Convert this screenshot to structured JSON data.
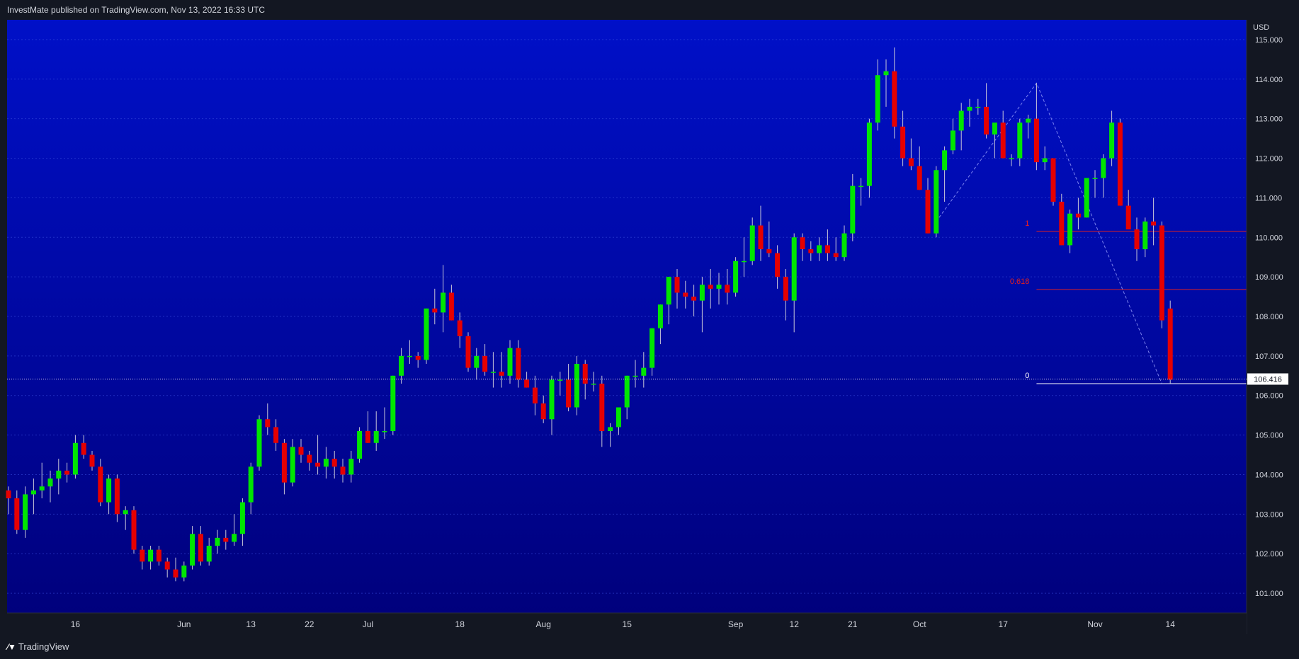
{
  "header": {
    "published": "InvestMate published on TradingView.com, Nov 13, 2022 16:33 UTC"
  },
  "footer": {
    "brand": "TradingView",
    "logo_icon": "tradingview-logo-icon"
  },
  "colors": {
    "bg_top": "#0010c8",
    "bg_bottom": "#00007a",
    "up": "#00e600",
    "down": "#e60000",
    "fib": "#e02020"
  },
  "chart_data": {
    "type": "candlestick",
    "currency": "USD",
    "ylim": [
      100.5,
      115.5
    ],
    "y_ticks": [
      "101.000",
      "102.000",
      "103.000",
      "104.000",
      "105.000",
      "106.000",
      "107.000",
      "108.000",
      "109.000",
      "110.000",
      "111.000",
      "112.000",
      "113.000",
      "114.000",
      "115.000"
    ],
    "x_ticks": [
      {
        "label": "16",
        "index": 8
      },
      {
        "label": "Jun",
        "index": 21
      },
      {
        "label": "13",
        "index": 29
      },
      {
        "label": "22",
        "index": 36
      },
      {
        "label": "Jul",
        "index": 43
      },
      {
        "label": "18",
        "index": 54
      },
      {
        "label": "Aug",
        "index": 64
      },
      {
        "label": "15",
        "index": 74
      },
      {
        "label": "Sep",
        "index": 87
      },
      {
        "label": "12",
        "index": 94
      },
      {
        "label": "21",
        "index": 101
      },
      {
        "label": "Oct",
        "index": 109
      },
      {
        "label": "17",
        "index": 119
      },
      {
        "label": "Nov",
        "index": 130
      },
      {
        "label": "14",
        "index": 139
      }
    ],
    "last_price": "106.416",
    "last_value": 106.416,
    "fib": [
      {
        "label": "1",
        "value": 110.15
      },
      {
        "label": "0.618",
        "value": 108.68
      },
      {
        "label": "0",
        "value": 106.3
      }
    ],
    "zigzag": [
      [
        111,
        110.4
      ],
      [
        123,
        113.9
      ],
      [
        138,
        106.3
      ]
    ],
    "candles": [
      [
        103.6,
        103.7,
        103.0,
        103.4
      ],
      [
        103.4,
        103.6,
        102.5,
        102.6
      ],
      [
        102.6,
        103.7,
        102.4,
        103.5
      ],
      [
        103.5,
        103.9,
        103.0,
        103.6
      ],
      [
        103.6,
        104.3,
        103.4,
        103.7
      ],
      [
        103.7,
        104.1,
        103.3,
        103.9
      ],
      [
        103.9,
        104.4,
        103.5,
        104.1
      ],
      [
        104.1,
        104.3,
        103.8,
        104.0
      ],
      [
        104.0,
        105.0,
        103.9,
        104.8
      ],
      [
        104.8,
        105.0,
        104.4,
        104.5
      ],
      [
        104.5,
        104.6,
        104.1,
        104.2
      ],
      [
        104.2,
        104.4,
        103.2,
        103.3
      ],
      [
        103.3,
        104.0,
        103.0,
        103.9
      ],
      [
        103.9,
        104.0,
        102.8,
        103.0
      ],
      [
        103.0,
        103.2,
        102.6,
        103.1
      ],
      [
        103.1,
        103.2,
        102.0,
        102.1
      ],
      [
        102.1,
        102.2,
        101.6,
        101.8
      ],
      [
        101.8,
        102.2,
        101.6,
        102.1
      ],
      [
        102.1,
        102.2,
        101.7,
        101.8
      ],
      [
        101.8,
        101.9,
        101.4,
        101.6
      ],
      [
        101.6,
        101.9,
        101.3,
        101.4
      ],
      [
        101.4,
        101.8,
        101.3,
        101.7
      ],
      [
        101.7,
        102.7,
        101.6,
        102.5
      ],
      [
        102.5,
        102.7,
        101.7,
        101.8
      ],
      [
        101.8,
        102.4,
        101.7,
        102.2
      ],
      [
        102.2,
        102.6,
        102.0,
        102.4
      ],
      [
        102.4,
        102.6,
        102.1,
        102.3
      ],
      [
        102.3,
        103.0,
        102.2,
        102.5
      ],
      [
        102.5,
        103.4,
        102.2,
        103.3
      ],
      [
        103.3,
        104.3,
        103.0,
        104.2
      ],
      [
        104.2,
        105.5,
        104.1,
        105.4
      ],
      [
        105.4,
        105.8,
        105.0,
        105.2
      ],
      [
        105.2,
        105.4,
        104.6,
        104.8
      ],
      [
        104.8,
        104.9,
        103.5,
        103.8
      ],
      [
        103.8,
        104.9,
        103.7,
        104.7
      ],
      [
        104.7,
        104.9,
        104.3,
        104.5
      ],
      [
        104.5,
        104.6,
        104.1,
        104.3
      ],
      [
        104.3,
        105.0,
        104.0,
        104.2
      ],
      [
        104.2,
        104.7,
        103.9,
        104.4
      ],
      [
        104.4,
        104.6,
        103.9,
        104.2
      ],
      [
        104.2,
        104.4,
        103.8,
        104.0
      ],
      [
        104.0,
        104.6,
        103.8,
        104.4
      ],
      [
        104.4,
        105.2,
        104.3,
        105.1
      ],
      [
        105.1,
        105.6,
        104.8,
        104.8
      ],
      [
        104.8,
        105.6,
        104.6,
        105.1
      ],
      [
        105.1,
        105.7,
        104.9,
        105.1
      ],
      [
        105.1,
        106.5,
        105.0,
        106.5
      ],
      [
        106.5,
        107.2,
        106.3,
        107.0
      ],
      [
        107.0,
        107.4,
        106.8,
        107.0
      ],
      [
        107.0,
        107.1,
        106.7,
        106.9
      ],
      [
        106.9,
        108.2,
        106.8,
        108.2
      ],
      [
        108.2,
        108.7,
        107.8,
        108.1
      ],
      [
        108.1,
        109.3,
        107.6,
        108.6
      ],
      [
        108.6,
        108.8,
        107.9,
        107.9
      ],
      [
        107.9,
        108.1,
        107.2,
        107.5
      ],
      [
        107.5,
        107.6,
        106.6,
        106.7
      ],
      [
        106.7,
        107.2,
        106.4,
        107.0
      ],
      [
        107.0,
        107.3,
        106.5,
        106.6
      ],
      [
        106.6,
        107.1,
        106.2,
        106.6
      ],
      [
        106.6,
        107.1,
        106.2,
        106.5
      ],
      [
        106.5,
        107.4,
        106.3,
        107.2
      ],
      [
        107.2,
        107.4,
        106.2,
        106.4
      ],
      [
        106.4,
        106.6,
        106.2,
        106.2
      ],
      [
        106.2,
        106.5,
        105.5,
        105.8
      ],
      [
        105.8,
        106.0,
        105.3,
        105.4
      ],
      [
        105.4,
        106.5,
        105.0,
        106.4
      ],
      [
        106.4,
        106.6,
        106.0,
        106.4
      ],
      [
        106.4,
        106.8,
        105.6,
        105.7
      ],
      [
        105.7,
        107.0,
        105.5,
        106.8
      ],
      [
        106.8,
        106.9,
        105.9,
        106.3
      ],
      [
        106.3,
        106.6,
        106.1,
        106.3
      ],
      [
        106.3,
        106.5,
        104.7,
        105.1
      ],
      [
        105.1,
        105.3,
        104.7,
        105.2
      ],
      [
        105.2,
        105.6,
        105.0,
        105.7
      ],
      [
        105.7,
        106.5,
        105.4,
        106.5
      ],
      [
        106.5,
        106.9,
        106.2,
        106.5
      ],
      [
        106.5,
        107.1,
        106.2,
        106.7
      ],
      [
        106.7,
        107.7,
        106.5,
        107.7
      ],
      [
        107.7,
        108.3,
        107.3,
        108.3
      ],
      [
        108.3,
        109.0,
        107.8,
        109.0
      ],
      [
        109.0,
        109.2,
        108.2,
        108.6
      ],
      [
        108.6,
        108.9,
        108.2,
        108.5
      ],
      [
        108.5,
        108.8,
        108.0,
        108.4
      ],
      [
        108.4,
        109.0,
        107.6,
        108.8
      ],
      [
        108.8,
        109.2,
        108.2,
        108.7
      ],
      [
        108.7,
        109.1,
        108.3,
        108.8
      ],
      [
        108.8,
        109.2,
        108.3,
        108.6
      ],
      [
        108.6,
        109.5,
        108.5,
        109.4
      ],
      [
        109.4,
        110.0,
        109.0,
        109.4
      ],
      [
        109.4,
        110.5,
        109.3,
        110.3
      ],
      [
        110.3,
        110.8,
        109.4,
        109.7
      ],
      [
        109.7,
        110.4,
        109.5,
        109.6
      ],
      [
        109.6,
        109.8,
        108.7,
        109.0
      ],
      [
        109.0,
        109.2,
        107.9,
        108.4
      ],
      [
        108.4,
        110.1,
        107.6,
        110.0
      ],
      [
        110.0,
        110.1,
        109.4,
        109.7
      ],
      [
        109.7,
        109.9,
        109.4,
        109.6
      ],
      [
        109.6,
        110.0,
        109.4,
        109.8
      ],
      [
        109.8,
        110.2,
        109.4,
        109.6
      ],
      [
        109.6,
        110.0,
        109.4,
        109.5
      ],
      [
        109.5,
        110.3,
        109.4,
        110.1
      ],
      [
        110.1,
        111.6,
        109.9,
        111.3
      ],
      [
        111.3,
        111.5,
        110.8,
        111.3
      ],
      [
        111.3,
        113.0,
        111.0,
        112.9
      ],
      [
        112.9,
        114.5,
        112.7,
        114.1
      ],
      [
        114.1,
        114.5,
        113.3,
        114.2
      ],
      [
        114.2,
        114.8,
        112.5,
        112.8
      ],
      [
        112.8,
        113.2,
        111.8,
        112.0
      ],
      [
        112.0,
        112.5,
        111.7,
        111.8
      ],
      [
        111.8,
        112.3,
        111.2,
        111.2
      ],
      [
        111.2,
        111.5,
        110.1,
        110.1
      ],
      [
        110.1,
        111.8,
        110.0,
        111.7
      ],
      [
        111.7,
        112.3,
        110.9,
        112.2
      ],
      [
        112.2,
        113.0,
        112.1,
        112.7
      ],
      [
        112.7,
        113.4,
        112.2,
        113.2
      ],
      [
        113.2,
        113.5,
        112.8,
        113.3
      ],
      [
        113.3,
        113.5,
        113.1,
        113.3
      ],
      [
        113.3,
        113.9,
        112.5,
        112.6
      ],
      [
        112.6,
        112.8,
        112.0,
        112.9
      ],
      [
        112.9,
        113.2,
        112.3,
        112.0
      ],
      [
        112.0,
        112.1,
        111.8,
        112.0
      ],
      [
        112.0,
        113.0,
        111.8,
        112.9
      ],
      [
        112.9,
        113.1,
        112.5,
        113.0
      ],
      [
        113.0,
        113.9,
        111.7,
        111.9
      ],
      [
        111.9,
        112.3,
        111.7,
        112.0
      ],
      [
        112.0,
        111.9,
        110.8,
        110.9
      ],
      [
        110.9,
        111.1,
        109.8,
        109.8
      ],
      [
        109.8,
        110.7,
        109.6,
        110.6
      ],
      [
        110.6,
        111.0,
        110.2,
        110.5
      ],
      [
        110.5,
        111.5,
        110.5,
        111.5
      ],
      [
        111.5,
        111.7,
        111.0,
        111.5
      ],
      [
        111.5,
        112.1,
        111.0,
        112.0
      ],
      [
        112.0,
        113.2,
        111.8,
        112.9
      ],
      [
        112.9,
        113.0,
        110.8,
        110.8
      ],
      [
        110.8,
        111.2,
        110.3,
        110.2
      ],
      [
        110.2,
        110.5,
        109.4,
        109.7
      ],
      [
        109.7,
        110.5,
        109.5,
        110.4
      ],
      [
        110.4,
        111.0,
        109.8,
        110.3
      ],
      [
        110.3,
        110.4,
        107.7,
        107.9
      ],
      [
        108.2,
        108.4,
        106.3,
        106.4
      ]
    ]
  }
}
